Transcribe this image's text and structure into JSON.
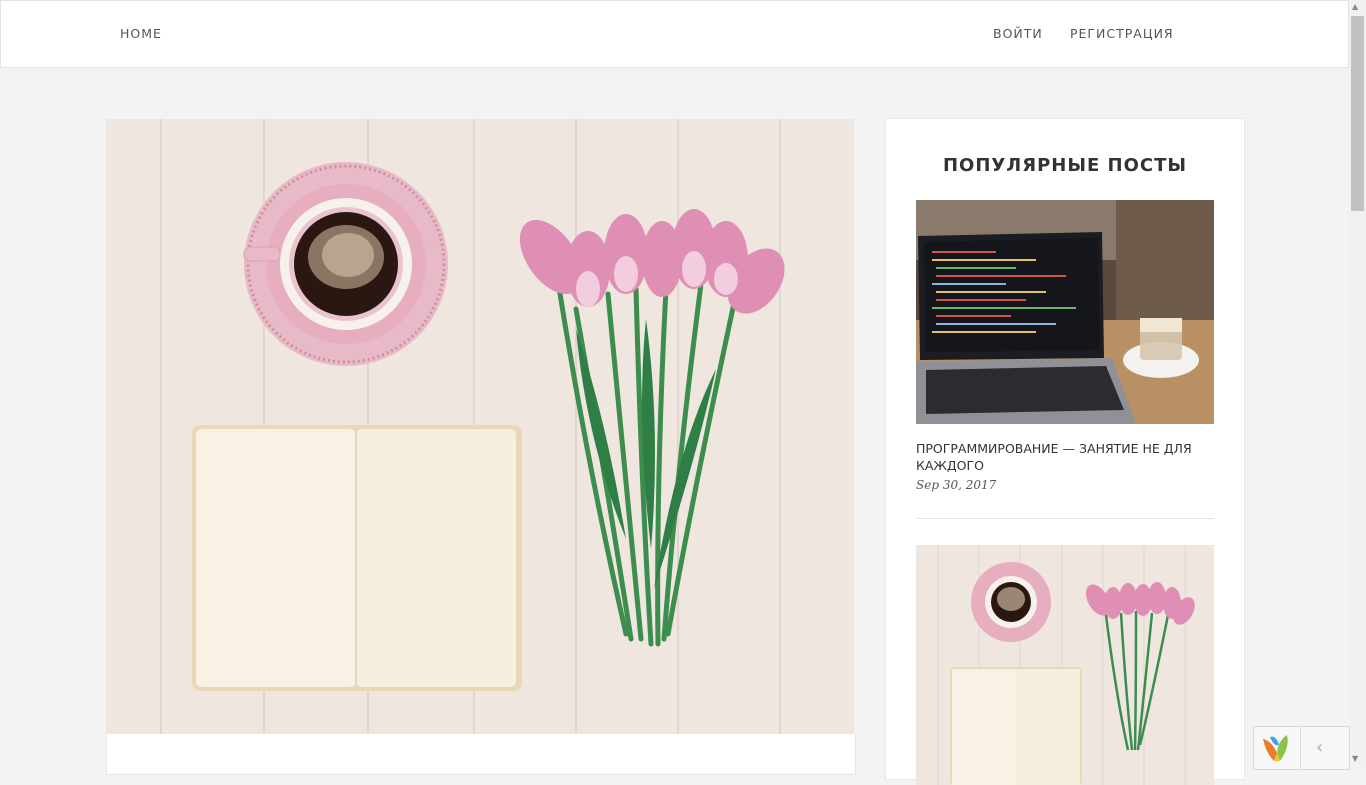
{
  "nav": {
    "home": "HOME",
    "login": "ВОЙТИ",
    "register": "РЕГИСТРАЦИЯ"
  },
  "sidebar": {
    "title": "ПОПУЛЯРНЫЕ ПОСТЫ",
    "posts": [
      {
        "title": "ПРОГРАММИРОВАНИЕ — ЗАНЯТИЕ НЕ ДЛЯ КАЖДОГО",
        "date": "Sep 30, 2017",
        "image": "laptop-code-photo"
      },
      {
        "image": "coffee-tulips-notebook-photo"
      }
    ]
  },
  "main": {
    "image": "coffee-tulips-notebook-photo"
  },
  "toolbar": {
    "logo": "yii-logo-icon",
    "toggle": "‹"
  },
  "colors": {
    "background": "#f3f3f3",
    "card": "#ffffff",
    "text": "#333333"
  }
}
